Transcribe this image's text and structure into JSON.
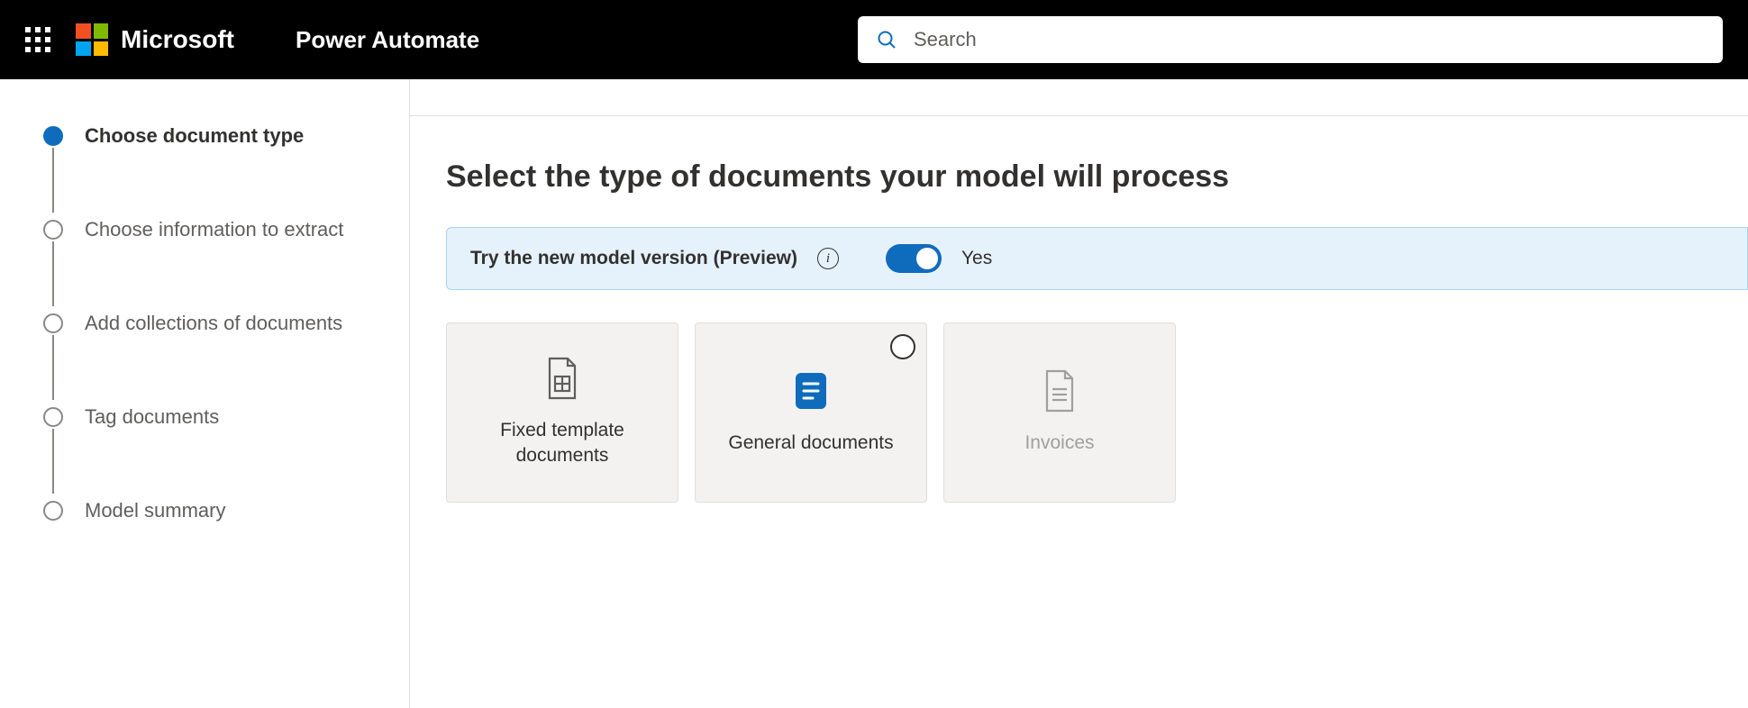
{
  "header": {
    "brand": "Microsoft",
    "app": "Power Automate",
    "search_placeholder": "Search"
  },
  "sidebar": {
    "steps": [
      {
        "label": "Choose document type",
        "active": true
      },
      {
        "label": "Choose information to extract",
        "active": false
      },
      {
        "label": "Add collections of documents",
        "active": false
      },
      {
        "label": "Tag documents",
        "active": false
      },
      {
        "label": "Model summary",
        "active": false
      }
    ]
  },
  "main": {
    "title": "Select the type of documents your model will process",
    "preview_banner": {
      "label": "Try the new model version (Preview)",
      "toggle_on": true,
      "toggle_text": "Yes"
    },
    "cards": [
      {
        "label": "Fixed template documents",
        "selected": false,
        "disabled": false,
        "icon": "template-doc"
      },
      {
        "label": "General documents",
        "selected": false,
        "show_radio": true,
        "disabled": false,
        "icon": "general-doc"
      },
      {
        "label": "Invoices",
        "selected": false,
        "disabled": true,
        "icon": "invoice-doc"
      }
    ]
  }
}
